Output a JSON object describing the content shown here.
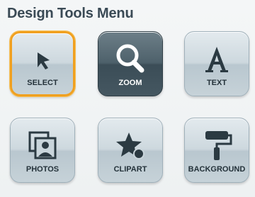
{
  "menu": {
    "title": "Design Tools Menu",
    "tools": [
      {
        "label": "SELECT",
        "icon": "cursor-arrow-icon",
        "state": "selected"
      },
      {
        "label": "ZOOM",
        "icon": "magnifier-icon",
        "state": "active"
      },
      {
        "label": "TEXT",
        "icon": "letter-a-icon",
        "state": "default"
      },
      {
        "label": "PHOTOS",
        "icon": "photos-icon",
        "state": "default"
      },
      {
        "label": "CLIPART",
        "icon": "star-shape-icon",
        "state": "default"
      },
      {
        "label": "BACKGROUND",
        "icon": "paint-roller-icon",
        "state": "default"
      }
    ]
  },
  "colors": {
    "selected_border": "#f0a020",
    "active_tile": "#4e616b",
    "icon": "#2b3a42"
  }
}
